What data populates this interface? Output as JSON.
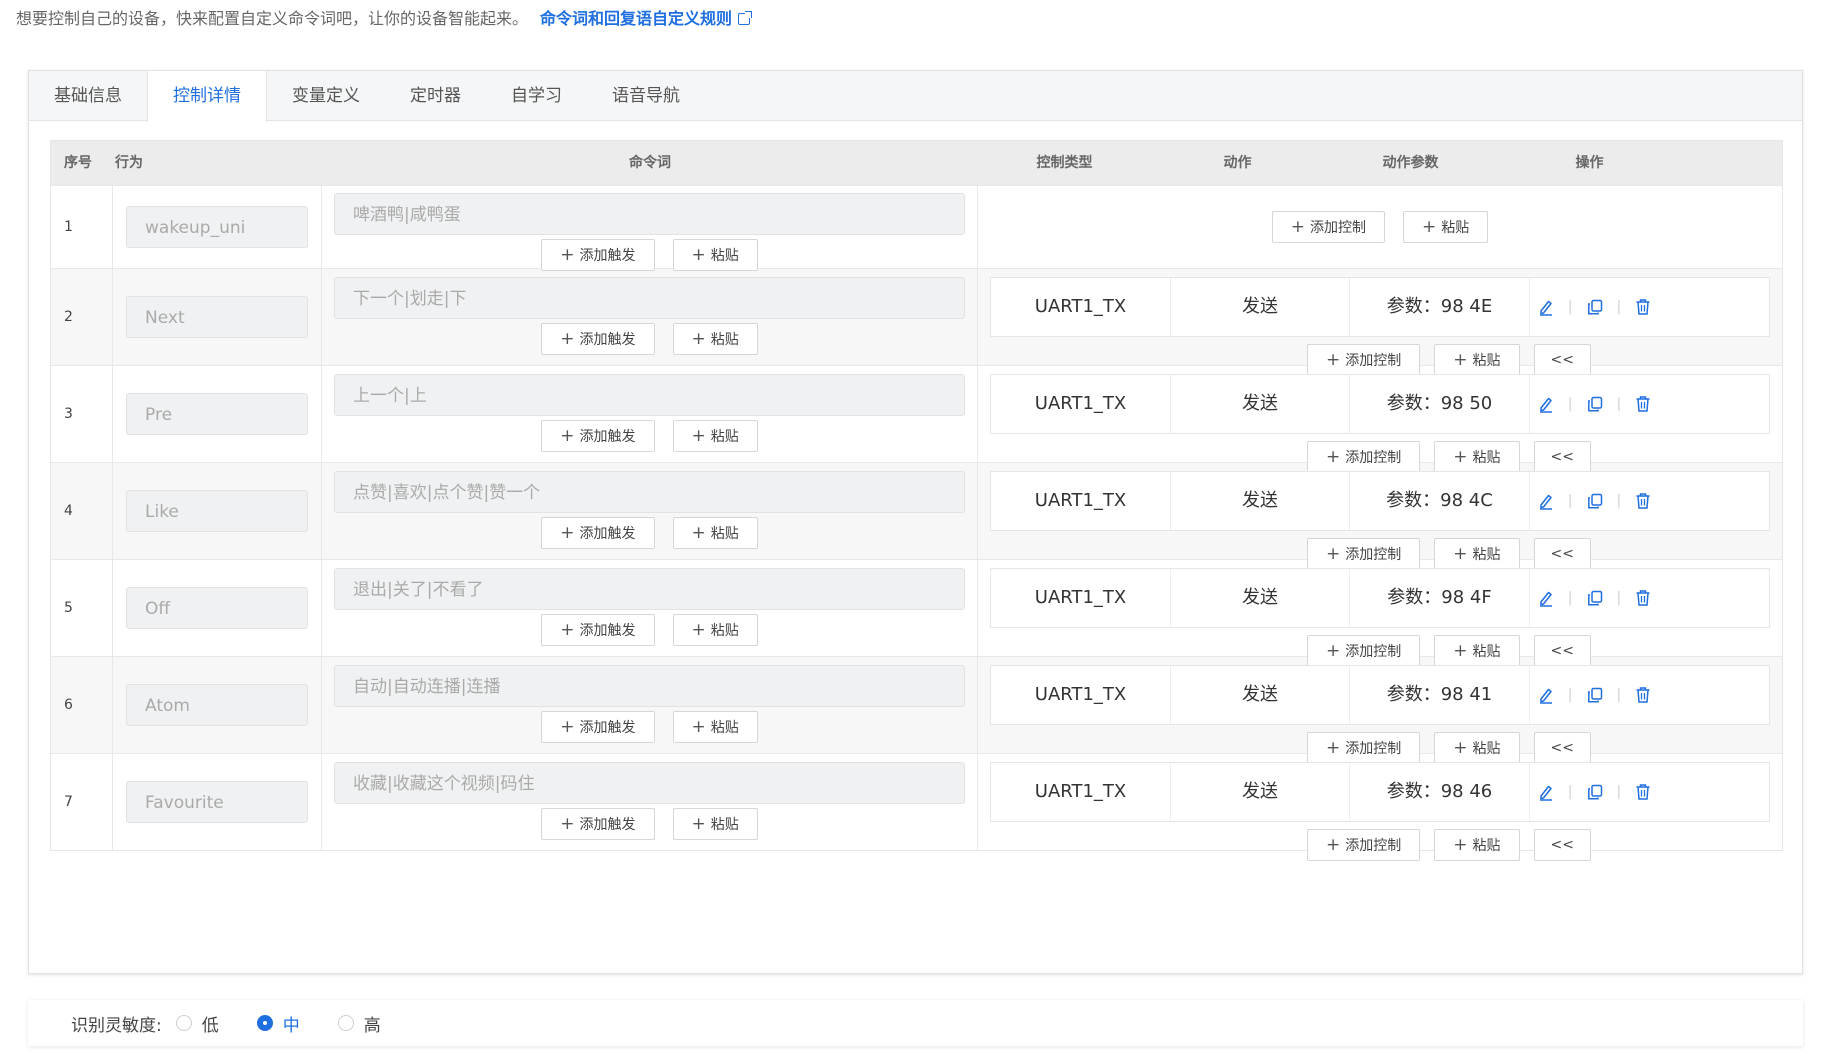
{
  "intro": {
    "text": "想要控制自己的设备，快来配置自定义命令词吧，让你的设备智能起来。",
    "link": "命令词和回复语自定义规则"
  },
  "tabs": [
    "基础信息",
    "控制详情",
    "变量定义",
    "定时器",
    "自学习",
    "语音导航"
  ],
  "active_tab": 1,
  "table": {
    "headers": {
      "no": "序号",
      "action": "行为",
      "command": "命令词",
      "ctrl_type": "控制类型",
      "act": "动作",
      "params": "动作参数",
      "ops": "操作"
    },
    "rows": [
      {
        "no": "1",
        "action": "wakeup_uni",
        "command": "啤酒鸭|咸鸭蛋"
      },
      {
        "no": "2",
        "action": "Next",
        "command": "下一个|划走|下",
        "ctrl_type": "UART1_TX",
        "act": "发送",
        "param": "参数：98 4E"
      },
      {
        "no": "3",
        "action": "Pre",
        "command": "上一个|上",
        "ctrl_type": "UART1_TX",
        "act": "发送",
        "param": "参数：98 50"
      },
      {
        "no": "4",
        "action": "Like",
        "command": "点赞|喜欢|点个赞|赞一个",
        "ctrl_type": "UART1_TX",
        "act": "发送",
        "param": "参数：98 4C"
      },
      {
        "no": "5",
        "action": "Off",
        "command": "退出|关了|不看了",
        "ctrl_type": "UART1_TX",
        "act": "发送",
        "param": "参数：98 4F"
      },
      {
        "no": "6",
        "action": "Atom",
        "command": "自动|自动连播|连播",
        "ctrl_type": "UART1_TX",
        "act": "发送",
        "param": "参数：98 41"
      },
      {
        "no": "7",
        "action": "Favourite",
        "command": "收藏|收藏这个视频|码住",
        "ctrl_type": "UART1_TX",
        "act": "发送",
        "param": "参数：98 46"
      }
    ]
  },
  "buttons": {
    "add_trigger": "添加触发",
    "paste": "粘贴",
    "add_control": "添加控制",
    "collapse": "<<"
  },
  "sensitivity": {
    "label": "识别灵敏度:",
    "options": [
      "低",
      "中",
      "高"
    ],
    "selected": 1
  },
  "colors": {
    "accent": "#1f6fe0"
  },
  "icons": {
    "edit": "edit-icon",
    "copy": "copy-icon",
    "delete": "delete-icon",
    "external": "external-link-icon"
  }
}
